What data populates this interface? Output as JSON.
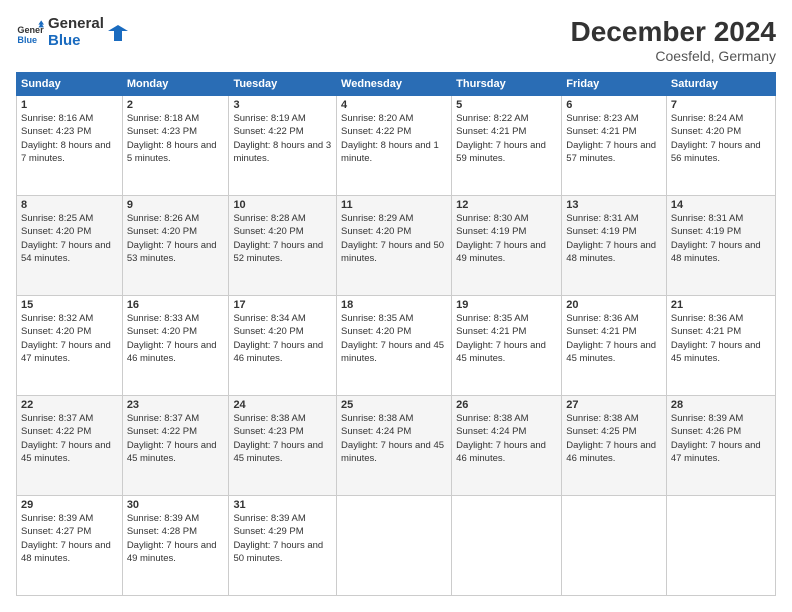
{
  "logo": {
    "text_general": "General",
    "text_blue": "Blue"
  },
  "header": {
    "title": "December 2024",
    "subtitle": "Coesfeld, Germany"
  },
  "columns": [
    "Sunday",
    "Monday",
    "Tuesday",
    "Wednesday",
    "Thursday",
    "Friday",
    "Saturday"
  ],
  "weeks": [
    [
      {
        "day": "1",
        "sunrise": "8:16 AM",
        "sunset": "4:23 PM",
        "daylight": "8 hours and 7 minutes."
      },
      {
        "day": "2",
        "sunrise": "8:18 AM",
        "sunset": "4:23 PM",
        "daylight": "8 hours and 5 minutes."
      },
      {
        "day": "3",
        "sunrise": "8:19 AM",
        "sunset": "4:22 PM",
        "daylight": "8 hours and 3 minutes."
      },
      {
        "day": "4",
        "sunrise": "8:20 AM",
        "sunset": "4:22 PM",
        "daylight": "8 hours and 1 minute."
      },
      {
        "day": "5",
        "sunrise": "8:22 AM",
        "sunset": "4:21 PM",
        "daylight": "7 hours and 59 minutes."
      },
      {
        "day": "6",
        "sunrise": "8:23 AM",
        "sunset": "4:21 PM",
        "daylight": "7 hours and 57 minutes."
      },
      {
        "day": "7",
        "sunrise": "8:24 AM",
        "sunset": "4:20 PM",
        "daylight": "7 hours and 56 minutes."
      }
    ],
    [
      {
        "day": "8",
        "sunrise": "8:25 AM",
        "sunset": "4:20 PM",
        "daylight": "7 hours and 54 minutes."
      },
      {
        "day": "9",
        "sunrise": "8:26 AM",
        "sunset": "4:20 PM",
        "daylight": "7 hours and 53 minutes."
      },
      {
        "day": "10",
        "sunrise": "8:28 AM",
        "sunset": "4:20 PM",
        "daylight": "7 hours and 52 minutes."
      },
      {
        "day": "11",
        "sunrise": "8:29 AM",
        "sunset": "4:20 PM",
        "daylight": "7 hours and 50 minutes."
      },
      {
        "day": "12",
        "sunrise": "8:30 AM",
        "sunset": "4:19 PM",
        "daylight": "7 hours and 49 minutes."
      },
      {
        "day": "13",
        "sunrise": "8:31 AM",
        "sunset": "4:19 PM",
        "daylight": "7 hours and 48 minutes."
      },
      {
        "day": "14",
        "sunrise": "8:31 AM",
        "sunset": "4:19 PM",
        "daylight": "7 hours and 48 minutes."
      }
    ],
    [
      {
        "day": "15",
        "sunrise": "8:32 AM",
        "sunset": "4:20 PM",
        "daylight": "7 hours and 47 minutes."
      },
      {
        "day": "16",
        "sunrise": "8:33 AM",
        "sunset": "4:20 PM",
        "daylight": "7 hours and 46 minutes."
      },
      {
        "day": "17",
        "sunrise": "8:34 AM",
        "sunset": "4:20 PM",
        "daylight": "7 hours and 46 minutes."
      },
      {
        "day": "18",
        "sunrise": "8:35 AM",
        "sunset": "4:20 PM",
        "daylight": "7 hours and 45 minutes."
      },
      {
        "day": "19",
        "sunrise": "8:35 AM",
        "sunset": "4:21 PM",
        "daylight": "7 hours and 45 minutes."
      },
      {
        "day": "20",
        "sunrise": "8:36 AM",
        "sunset": "4:21 PM",
        "daylight": "7 hours and 45 minutes."
      },
      {
        "day": "21",
        "sunrise": "8:36 AM",
        "sunset": "4:21 PM",
        "daylight": "7 hours and 45 minutes."
      }
    ],
    [
      {
        "day": "22",
        "sunrise": "8:37 AM",
        "sunset": "4:22 PM",
        "daylight": "7 hours and 45 minutes."
      },
      {
        "day": "23",
        "sunrise": "8:37 AM",
        "sunset": "4:22 PM",
        "daylight": "7 hours and 45 minutes."
      },
      {
        "day": "24",
        "sunrise": "8:38 AM",
        "sunset": "4:23 PM",
        "daylight": "7 hours and 45 minutes."
      },
      {
        "day": "25",
        "sunrise": "8:38 AM",
        "sunset": "4:24 PM",
        "daylight": "7 hours and 45 minutes."
      },
      {
        "day": "26",
        "sunrise": "8:38 AM",
        "sunset": "4:24 PM",
        "daylight": "7 hours and 46 minutes."
      },
      {
        "day": "27",
        "sunrise": "8:38 AM",
        "sunset": "4:25 PM",
        "daylight": "7 hours and 46 minutes."
      },
      {
        "day": "28",
        "sunrise": "8:39 AM",
        "sunset": "4:26 PM",
        "daylight": "7 hours and 47 minutes."
      }
    ],
    [
      {
        "day": "29",
        "sunrise": "8:39 AM",
        "sunset": "4:27 PM",
        "daylight": "7 hours and 48 minutes."
      },
      {
        "day": "30",
        "sunrise": "8:39 AM",
        "sunset": "4:28 PM",
        "daylight": "7 hours and 49 minutes."
      },
      {
        "day": "31",
        "sunrise": "8:39 AM",
        "sunset": "4:29 PM",
        "daylight": "7 hours and 50 minutes."
      },
      null,
      null,
      null,
      null
    ]
  ]
}
